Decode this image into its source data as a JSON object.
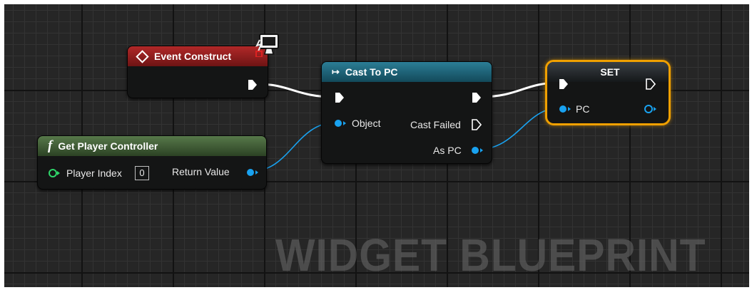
{
  "graph_type": "Widget Blueprint event graph",
  "watermark": "WIDGET BLUEPRINT",
  "colors": {
    "event_header": "#8a1c1c",
    "function_header": "#3c5a2e",
    "cast_header": "#1e5f73",
    "exec_wire": "#ffffff",
    "object_pin": "#19a2f0",
    "int_pin": "#2fd66a",
    "selection": "#f0a000"
  },
  "nodes": {
    "event_construct": {
      "title": "Event Construct",
      "header_icon": "event-diamond-icon",
      "badge_icon": "client-monitor-icon"
    },
    "get_player_controller": {
      "title": "Get Player Controller",
      "header_icon": "function-f-icon",
      "input_label": "Player Index",
      "input_value": "0",
      "output_label": "Return Value"
    },
    "cast_to_pc": {
      "title": "Cast To PC",
      "header_icon": "cast-arrow-icon",
      "object_label": "Object",
      "cast_failed_label": "Cast Failed",
      "as_pc_label": "As PC"
    },
    "set_node": {
      "title": "SET",
      "pc_label": "PC",
      "selected": true
    }
  }
}
